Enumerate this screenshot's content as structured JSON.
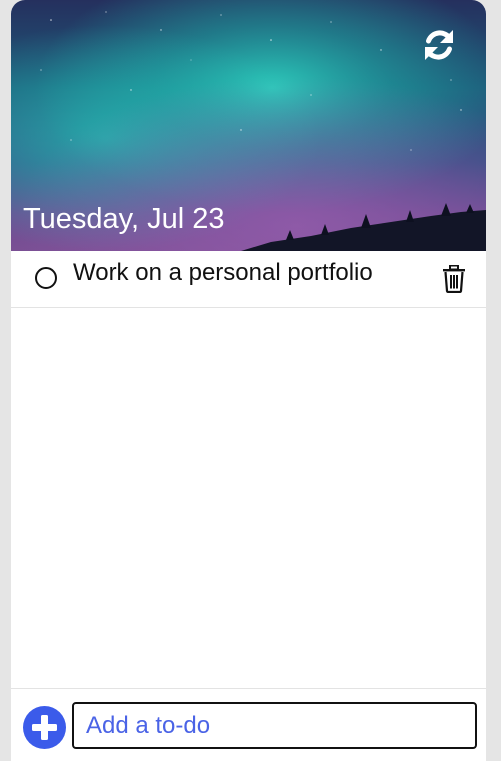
{
  "header": {
    "date": "Tuesday, Jul 23",
    "background_icon": "aurora-night-sky",
    "refresh_icon": "refresh-icon"
  },
  "todos": [
    {
      "text": "Work on a personal portfolio",
      "completed": false,
      "check_icon": "empty-circle-icon",
      "delete_icon": "trash-icon"
    }
  ],
  "footer": {
    "add_icon": "plus-circle-icon",
    "input_placeholder": "Add a to-do",
    "input_value": ""
  },
  "colors": {
    "accent": "#3b5bea",
    "placeholder": "#4a63e6",
    "page_bg": "#e5e5e5",
    "card_bg": "#ffffff"
  }
}
